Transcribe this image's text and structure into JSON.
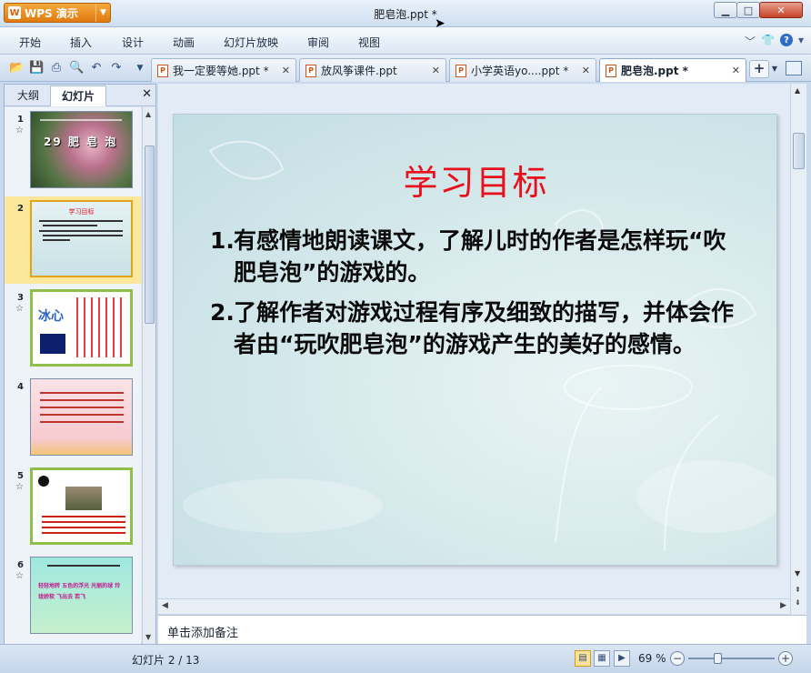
{
  "app": {
    "name": "WPS 演示",
    "window_title": "肥皂泡.ppt *"
  },
  "menu": [
    "开始",
    "插入",
    "设计",
    "动画",
    "幻灯片放映",
    "审阅",
    "视图"
  ],
  "tabs": [
    {
      "label": "我一定要等她.ppt *",
      "active": false
    },
    {
      "label": "放风筝课件.ppt",
      "active": false
    },
    {
      "label": "小学英语yo....ppt *",
      "active": false
    },
    {
      "label": "肥皂泡.ppt *",
      "active": true
    }
  ],
  "left_panel": {
    "tabs": [
      "大纲",
      "幻灯片"
    ],
    "active_tab": "幻灯片",
    "thumbnails": [
      {
        "number": "1",
        "star": true,
        "title_text": "29 肥 皂 泡"
      },
      {
        "number": "2",
        "star": false,
        "selected": true,
        "title_text": "学习目标"
      },
      {
        "number": "3",
        "star": true,
        "title_text": "冰心"
      },
      {
        "number": "4",
        "star": false
      },
      {
        "number": "5",
        "star": true
      },
      {
        "number": "6",
        "star": true,
        "title_text": "轻轻地转 五色的浮光 光丽的球 玲珑娇软 飞出去 若飞"
      }
    ]
  },
  "slide": {
    "title": "学习目标",
    "goals": [
      {
        "num": "1.",
        "text": "有感情地朗读课文，了解儿时的作者是怎样玩“吹肥皂泡”的游戏的。"
      },
      {
        "num": "2.",
        "text": "了解作者对游戏过程有序及细致的描写，并体会作者由“玩吹肥皂泡”的游戏产生的美好的感情。"
      }
    ]
  },
  "notes_placeholder": "单击添加备注",
  "status": {
    "slide_indicator": "幻灯片 2 / 13",
    "zoom": "69 %",
    "zoom_value": 69
  },
  "colors": {
    "slide_title": "#e8101a",
    "selection": "#fde79a",
    "app_button": "#e07a10"
  }
}
